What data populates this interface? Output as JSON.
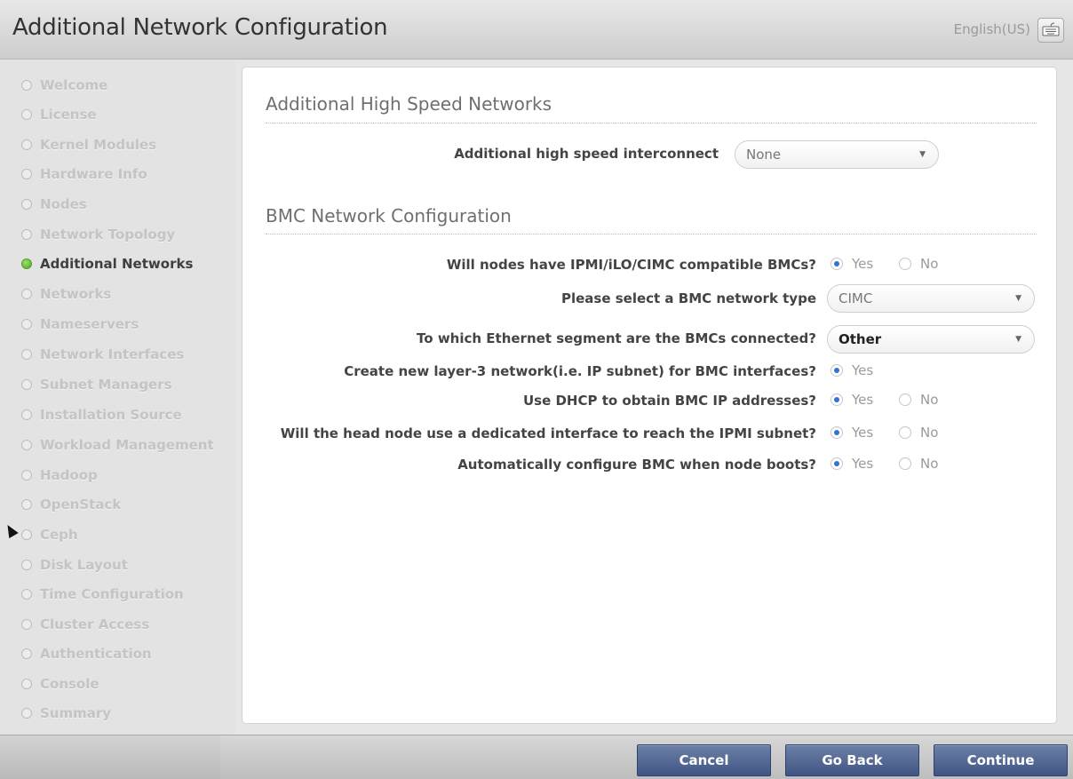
{
  "header": {
    "title": "Additional Network Configuration",
    "language": "English(US)",
    "keyboard_icon": "keyboard-icon"
  },
  "sidebar": {
    "active_index": 6,
    "items": [
      "Welcome",
      "License",
      "Kernel Modules",
      "Hardware Info",
      "Nodes",
      "Network Topology",
      "Additional Networks",
      "Networks",
      "Nameservers",
      "Network Interfaces",
      "Subnet Managers",
      "Installation Source",
      "Workload Management",
      "Hadoop",
      "OpenStack",
      "Ceph",
      "Disk Layout",
      "Time Configuration",
      "Cluster Access",
      "Authentication",
      "Console",
      "Summary"
    ]
  },
  "sections": {
    "high_speed": {
      "title": "Additional High Speed Networks",
      "interconnect_label": "Additional high speed interconnect",
      "interconnect_value": "None"
    },
    "bmc": {
      "title": "BMC Network Configuration",
      "compatible_label": "Will nodes have IPMI/iLO/CIMC compatible BMCs?",
      "type_label": "Please select a BMC network type",
      "type_value": "CIMC",
      "segment_label": "To which Ethernet segment are the BMCs connected?",
      "segment_value": "Other",
      "layer3_label": "Create new layer-3 network(i.e. IP subnet) for BMC interfaces?",
      "dhcp_label": "Use DHCP to obtain BMC IP addresses?",
      "dedicated_label": "Will the head node use a dedicated interface to reach the IPMI subnet?",
      "autoconfig_label": "Automatically configure BMC when node boots?",
      "yes": "Yes",
      "no": "No"
    }
  },
  "footer": {
    "cancel": "Cancel",
    "go_back": "Go Back",
    "continue": "Continue"
  },
  "colors": {
    "accent_button": "#4a5e8c",
    "active_dot": "#6cc33a",
    "radio_checked": "#2f74d0"
  }
}
